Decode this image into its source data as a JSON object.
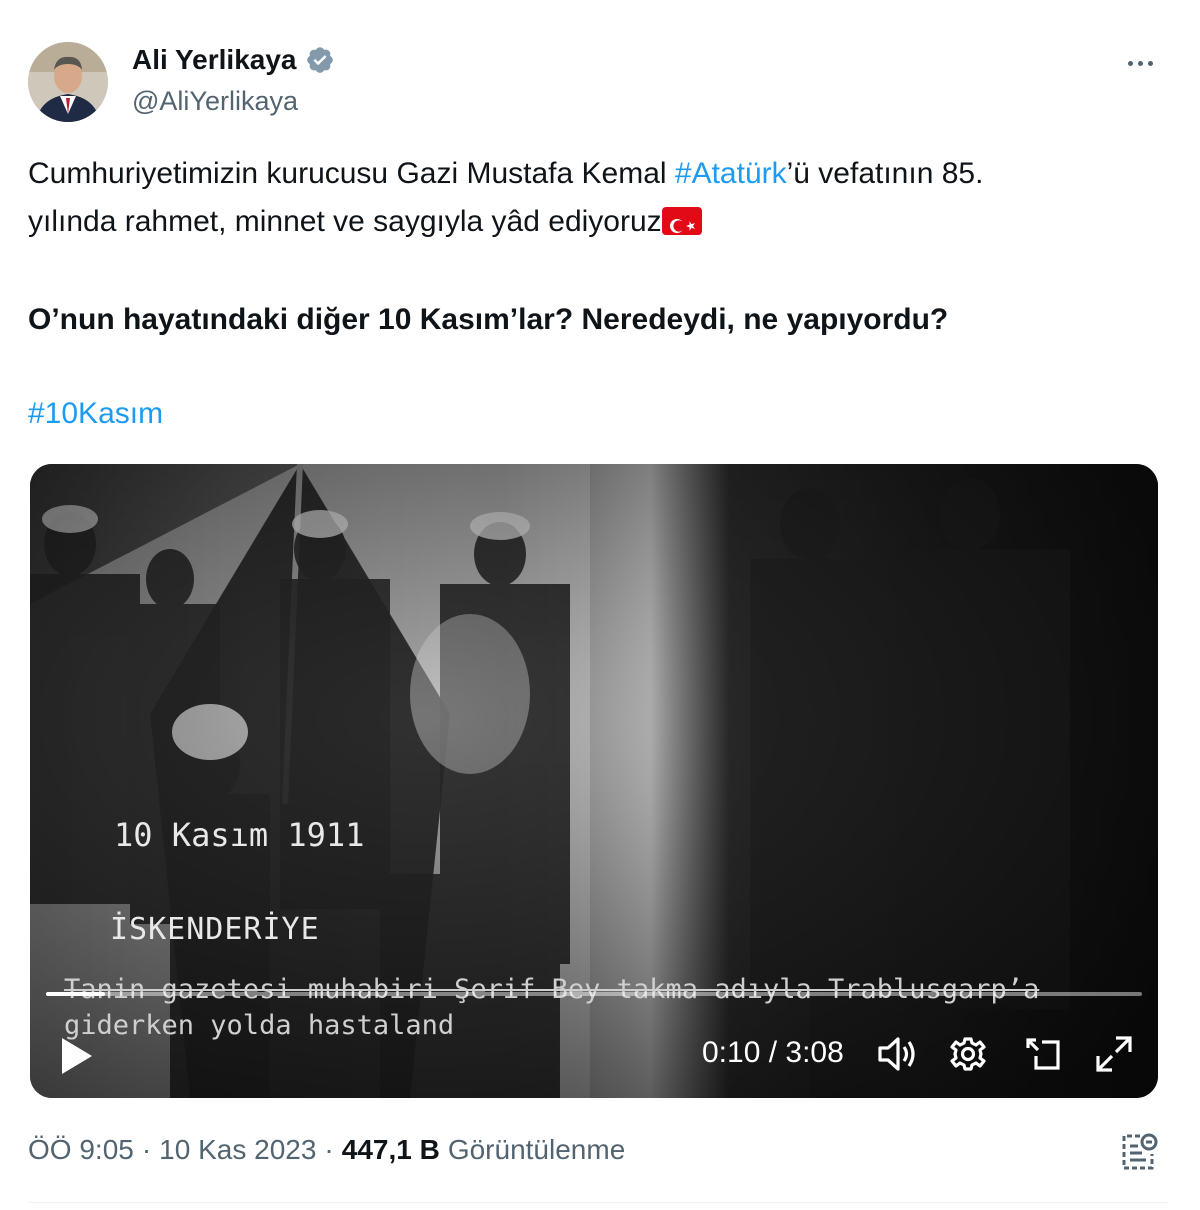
{
  "author": {
    "display_name": "Ali Yerlikaya",
    "handle": "@AliYerlikaya",
    "avatar_icon": "profile-photo",
    "verified_icon": "verified-badge-icon"
  },
  "menu": {
    "more_icon": "more-dots-icon"
  },
  "body": {
    "line1_pre": "Cumhuriyetimizin kurucusu Gazi Mustafa Kemal ",
    "line1_link": "#Atatürk",
    "line1_post": "’ü vefatının 85.",
    "line2": "yılında rahmet, minnet ve saygıyla yâd ediyoruz",
    "line2_emoji": "turkey-flag-icon",
    "line3": "O’nun hayatındaki diğer 10 Kasım’lar? Neredeydi, ne yapıyordu?",
    "hashtag": "#10Kasım"
  },
  "video": {
    "date_caption": "10 Kasım 1911",
    "place_caption": "İSKENDERİYE",
    "subtitle_line1": "Tanin gazetesi muhabiri Şerif Bey takma adıyla Trablusgarp’a",
    "subtitle_line2": "giderken yolda hastaland",
    "time": "0:10 / 3:08",
    "progress_fraction": 0.054,
    "controls": [
      "play-icon",
      "volume-icon",
      "settings-gear-icon",
      "picture-in-picture-icon",
      "fullscreen-icon"
    ]
  },
  "meta": {
    "time": "ÖÖ 9:05",
    "sep1": "·",
    "date": "10 Kas 2023",
    "sep2": "·",
    "views": "447,1 B",
    "views_label": "Görüntülenme",
    "analytics_icon": "analytics-icon"
  },
  "colors": {
    "link": "#1d9bf0",
    "muted": "#536471",
    "text": "#0f1419",
    "flag": "#e30a17"
  }
}
